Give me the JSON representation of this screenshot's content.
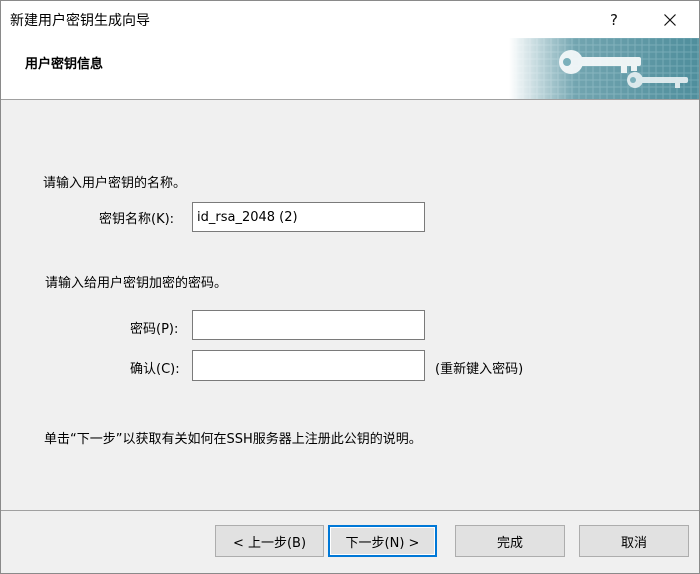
{
  "window": {
    "title": "新建用户密钥生成向导",
    "help_glyph": "?"
  },
  "header": {
    "title": "用户密钥信息",
    "art_icon": "key-icon"
  },
  "key_name_section": {
    "prompt": "请输入用户密钥的名称。",
    "label": "密钥名称(K):",
    "value": "id_rsa_2048 (2)"
  },
  "password_section": {
    "prompt": "请输入给用户密钥加密的密码。",
    "password_label": "密码(P):",
    "password_value": "",
    "confirm_label": "确认(C):",
    "confirm_value": "",
    "confirm_hint": "(重新键入密码)"
  },
  "info_text": "单击“下一步”以获取有关如何在SSH服务器上注册此公钥的说明。",
  "buttons": {
    "back": "< 上一步(B)",
    "next": "下一步(N) >",
    "finish": "完成",
    "cancel": "取消"
  },
  "colors": {
    "accent": "#0078d7",
    "header_art": "#5a9aa8"
  }
}
